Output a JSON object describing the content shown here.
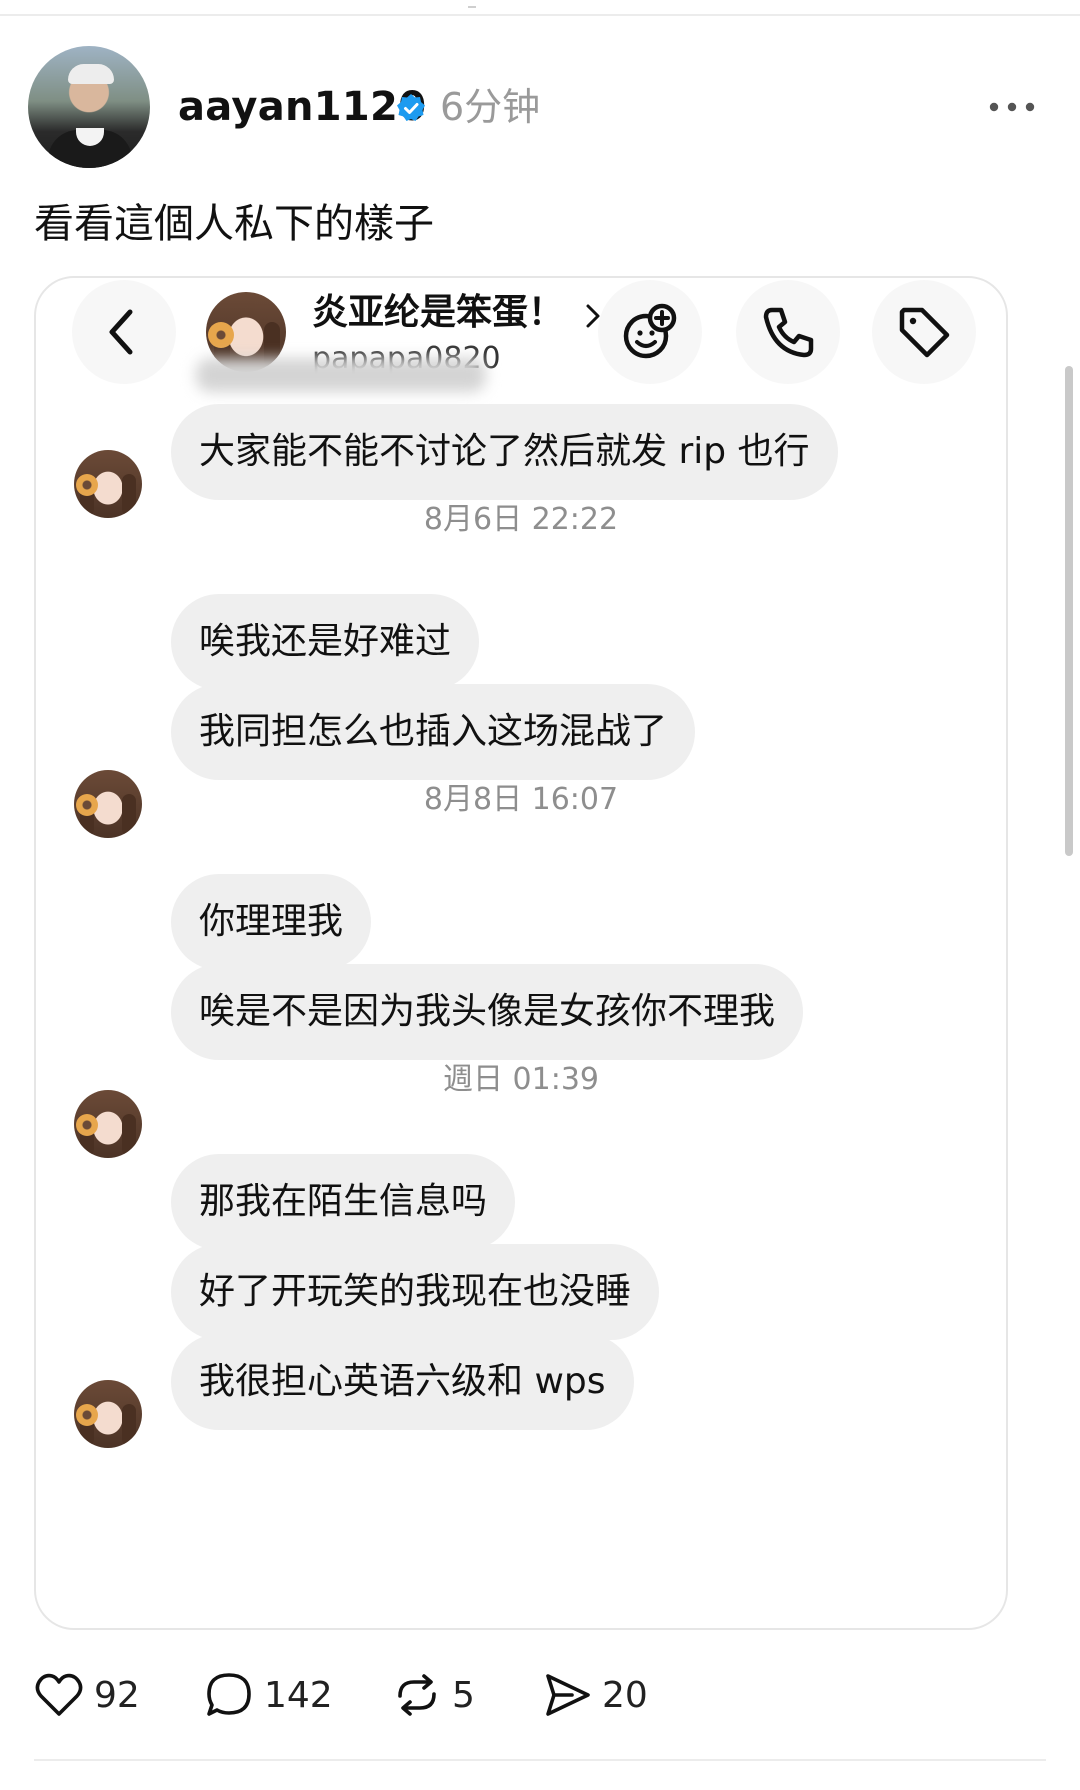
{
  "post": {
    "username": "aayan1120",
    "time": "6分钟",
    "caption": "看看這個人私下的樣子"
  },
  "dm": {
    "chat_name": "炎亚纶是笨蛋！",
    "handle": "papapa0820",
    "messages": [
      "大家能不能不讨论了然后就发 rip 也行",
      "唉我还是好难过",
      "我同担怎么也插入这场混战了",
      "你理理我",
      "唉是不是因为我头像是女孩你不理我",
      "那我在陌生信息吗",
      "好了开玩笑的我现在也没睡",
      "我很担心英语六级和 wps"
    ],
    "timestamps": [
      "8月6日 22:22",
      "8月8日 16:07",
      "週日 01:39"
    ]
  },
  "actions": {
    "likes": "92",
    "replies": "142",
    "reposts": "5",
    "shares": "20"
  },
  "colors": {
    "verified": "#1d9bf0",
    "bubble": "#efefef",
    "timestamp": "#8e8e8e"
  },
  "icons": [
    "verified-icon",
    "more-icon",
    "back-icon",
    "effects-icon",
    "call-icon",
    "tag-icon",
    "chevron-right-icon",
    "heart-icon",
    "comment-icon",
    "repost-icon",
    "share-icon"
  ]
}
